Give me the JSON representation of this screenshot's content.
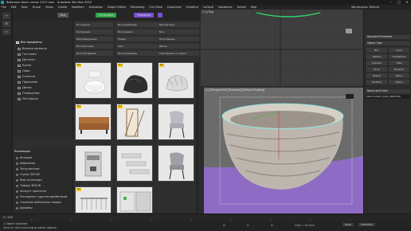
{
  "window": {
    "title": "Bathroom black corner 2017.max - Autodesk 3ds Max 2023",
    "min": "–",
    "max": "▢",
    "close": "✕"
  },
  "menubar": {
    "items": [
      "File",
      "Edit",
      "Tools",
      "Group",
      "Views",
      "Create",
      "Modifiers",
      "Animation",
      "Graph Editors",
      "Rendering",
      "Civil View",
      "Customize",
      "Scripting",
      "CoCkpit",
      "Substance",
      "Arnold",
      "Help"
    ],
    "workspace": "Workspaces: Default"
  },
  "library": {
    "tab_all": "Все",
    "tab_green": "Установка",
    "tab_blue": "Подписка",
    "tree_root": "Все предметы",
    "tree": [
      "Ванная комната",
      "Гостиная",
      "Детская",
      "Кухня",
      "Офис",
      "Спальня",
      "Прихожая",
      "Декор",
      "Освещение",
      "Экстерьер"
    ],
    "filters": [
      "По модели",
      "Все дизайнеры",
      "Бесплатные",
      "Коллекция",
      "Все модели",
      "Все",
      "Рекомендуемые",
      "Новые",
      "Популярные",
      "Все текстуры",
      "Свет",
      "Декор",
      "Все платформы",
      "Все материалы",
      "Сортировать по дате"
    ],
    "categories_title": "Коллекции",
    "categories": [
      "История",
      "Избранное",
      "Загруженные",
      "Сцены 3DCUB",
      "Мои коллекции",
      "Товары 3DCUB",
      "Аккаунт приятеля",
      "Последние с другим дизайнером",
      "Сложные мебельные товары",
      "Дизайны"
    ],
    "badge": "Pro"
  },
  "viewport": {
    "main_label": "[+] [Perspective] [Standard] [Default Shading]",
    "top_label": "[+] [Top]"
  },
  "command_panel": {
    "standard_primitives": "Standard Primitives",
    "object_type": "Object Type",
    "buttons": [
      "Box",
      "Cone",
      "Sphere",
      "GeoSphere",
      "Cylinder",
      "Tube",
      "Torus",
      "Pyramid",
      "Teapot",
      "Plane",
      "TextPlus",
      "Hedra"
    ],
    "name_and_color": "Name and Color",
    "object_name": "black-ceramic_bowl_Sketchfab"
  },
  "timeline": {
    "frame": "0 / 100"
  },
  "status": {
    "selected": "1 Object Selected",
    "hint": "Click or click-and-drag to select objects",
    "x": "X:",
    "y": "Y:",
    "z": "Z:",
    "grid": "Grid = 10,0cm",
    "auto": "Auto",
    "selected_key": "Selected"
  },
  "colors": {
    "purple_floor": "#8e6bc4",
    "green_btn": "#2ea84a",
    "purple_btn": "#7a4fd0",
    "accent": "#1aa3a3"
  }
}
